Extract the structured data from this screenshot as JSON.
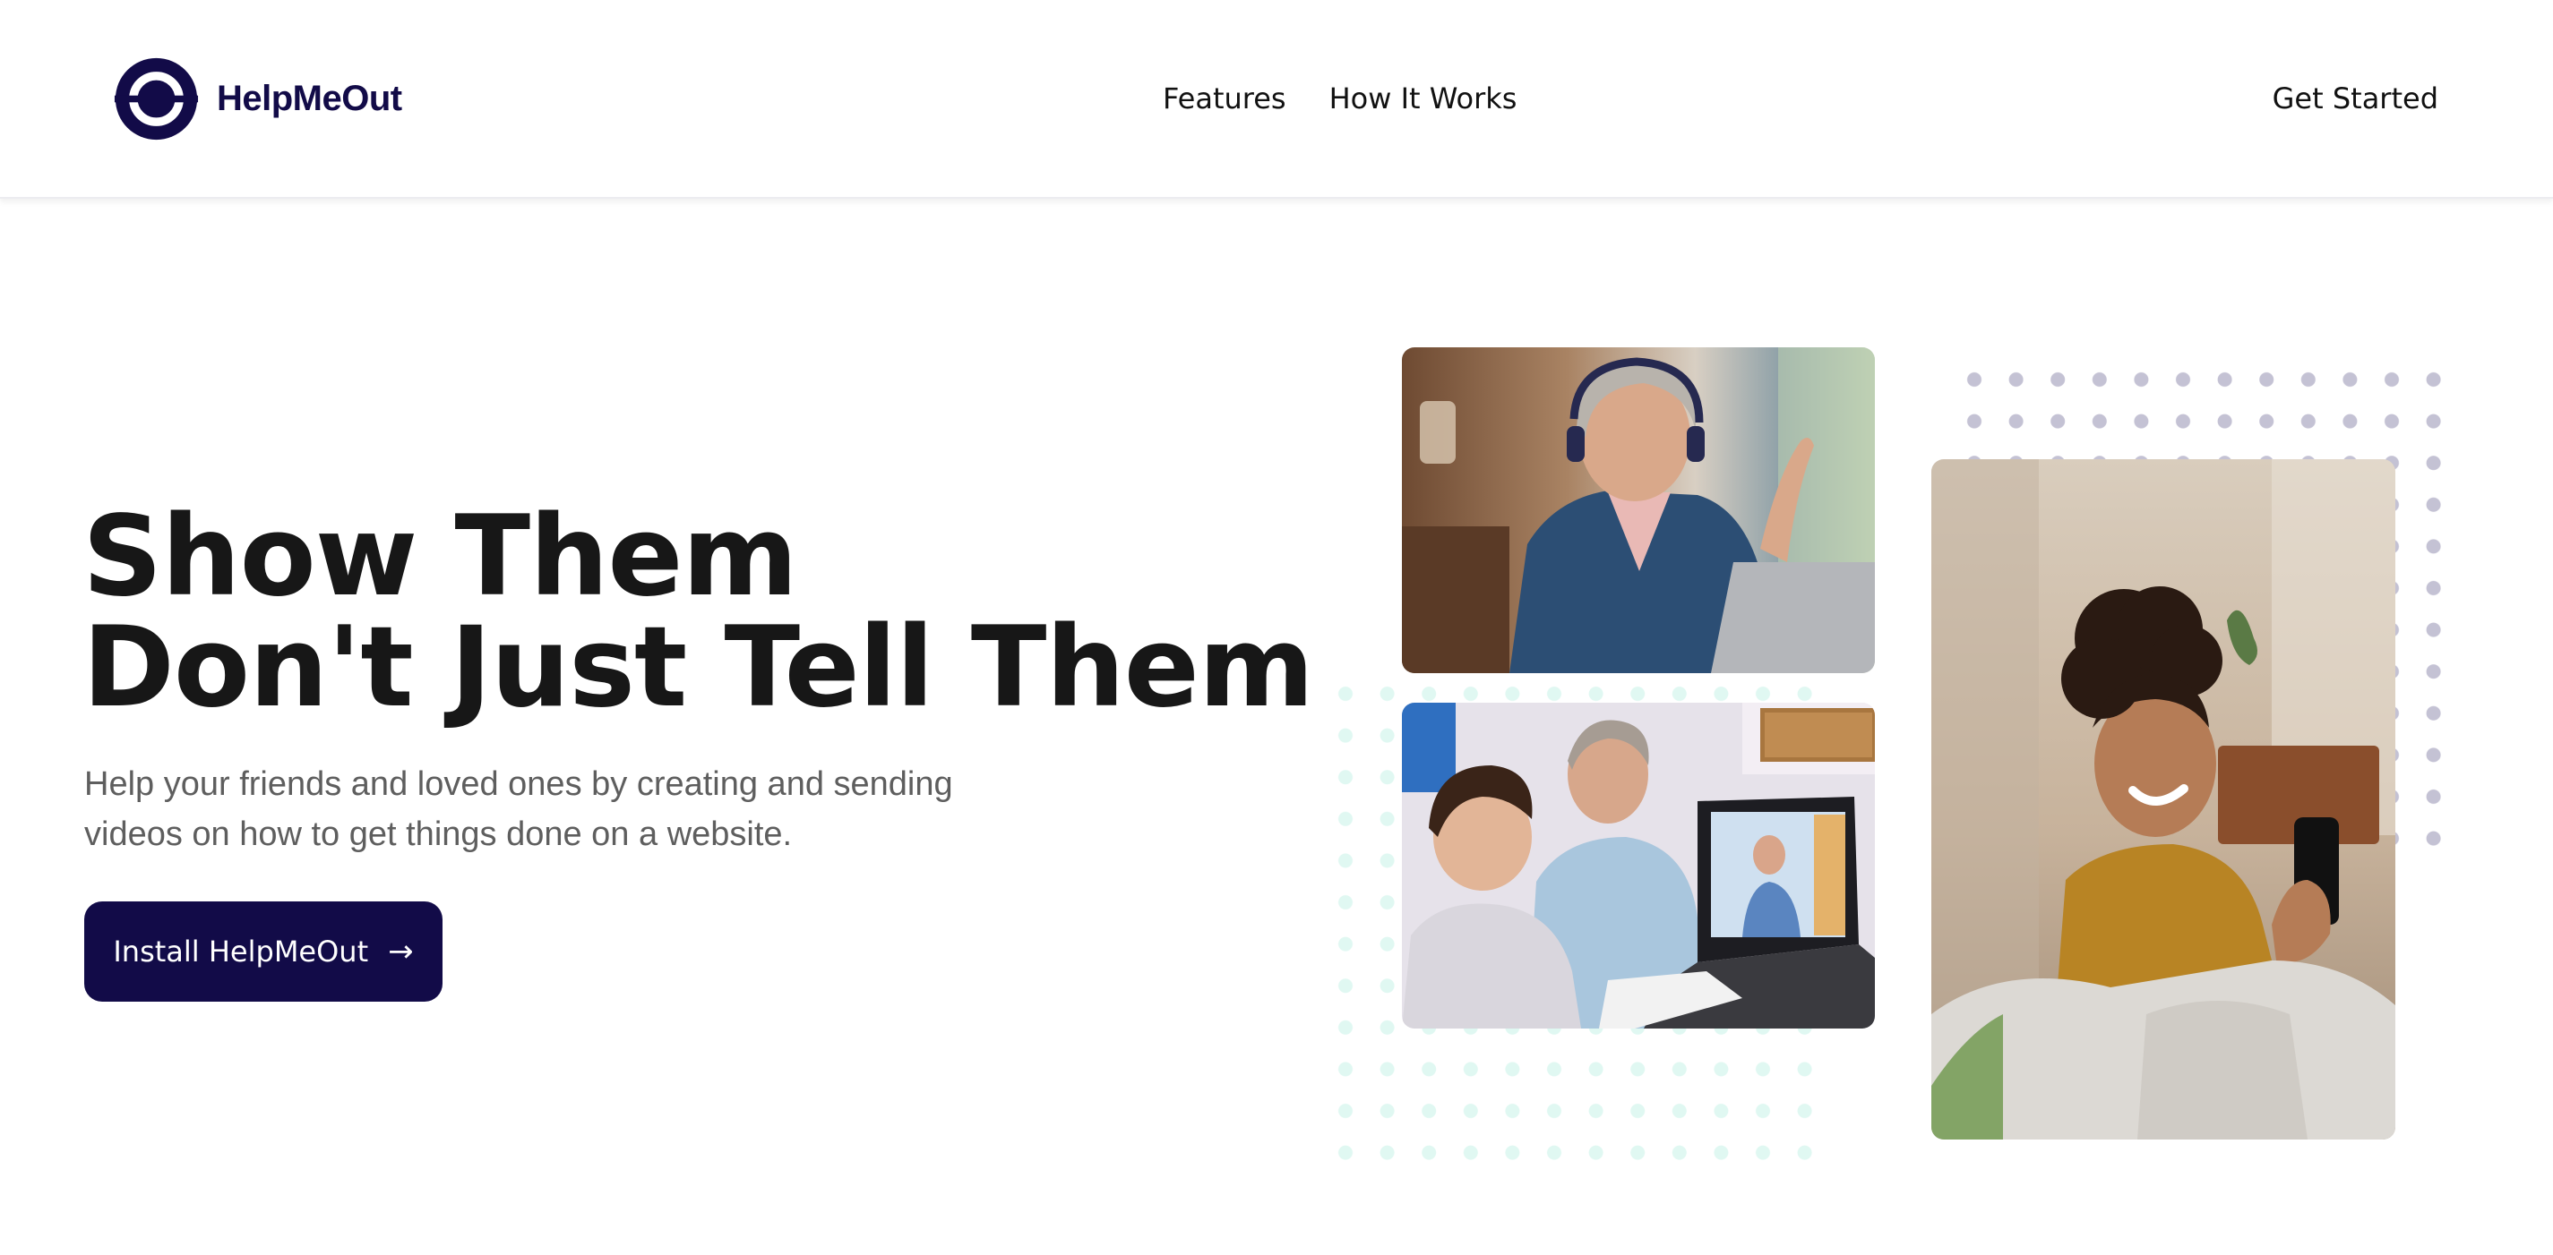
{
  "navbar": {
    "brand_name": "HelpMeOut",
    "links": [
      {
        "label": "Features"
      },
      {
        "label": "How It Works"
      }
    ],
    "cta_label": "Get Started"
  },
  "hero": {
    "title_line1": "Show Them",
    "title_line2": "Don't Just Tell Them",
    "subtitle": "Help your friends and loved ones by creating and sending videos on how to get things done on a website.",
    "cta_label": "Install HelpMeOut",
    "cta_icon": "arrow-right-icon"
  },
  "colors": {
    "brand_navy": "#120b48",
    "heading": "#171717",
    "body_text": "#5e5e5e",
    "dots_mint": "#e0f8f2",
    "dots_lavender": "#c4c2d4"
  },
  "images": [
    {
      "name": "woman-with-headphones-on-laptop-photo"
    },
    {
      "name": "grandfather-and-boy-at-laptop-photo"
    },
    {
      "name": "smiling-woman-with-phone-photo"
    }
  ]
}
